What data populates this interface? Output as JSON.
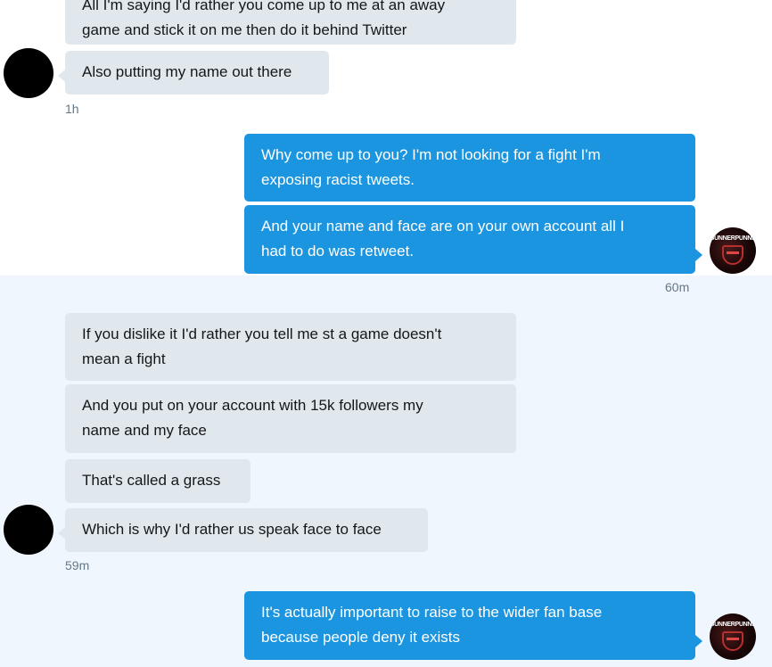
{
  "conversation": {
    "messages": [
      {
        "text": "All I'm saying I'd rather you come up to me at an away\ngame and stick it on me then do it behind Twitter"
      },
      {
        "text": "Also putting my name out there"
      },
      {
        "text": "Why come up to you? I'm not looking for a fight I'm\nexposing racist tweets."
      },
      {
        "text": "And your name and face are on your own account all I\nhad to do was retweet."
      },
      {
        "text": "If you dislike it I'd rather you tell me st a game doesn't\nmean a fight"
      },
      {
        "text": "And you put on your account with 15k followers my\nname and my face"
      },
      {
        "text": "That's called a grass"
      },
      {
        "text": "Which is why I'd rather us speak face to face"
      },
      {
        "text": "It's actually important to raise to the wider fan base\nbecause people deny it exists"
      }
    ],
    "timestamps": [
      "1h",
      "60m",
      "59m"
    ],
    "own_avatar_text": "GUNNERPUNNER"
  },
  "colors": {
    "sent_bubble": "#1b95e0",
    "received_bubble": "#e1e8ed",
    "highlight_band": "#f0f6fd",
    "timestamp": "#657786"
  }
}
